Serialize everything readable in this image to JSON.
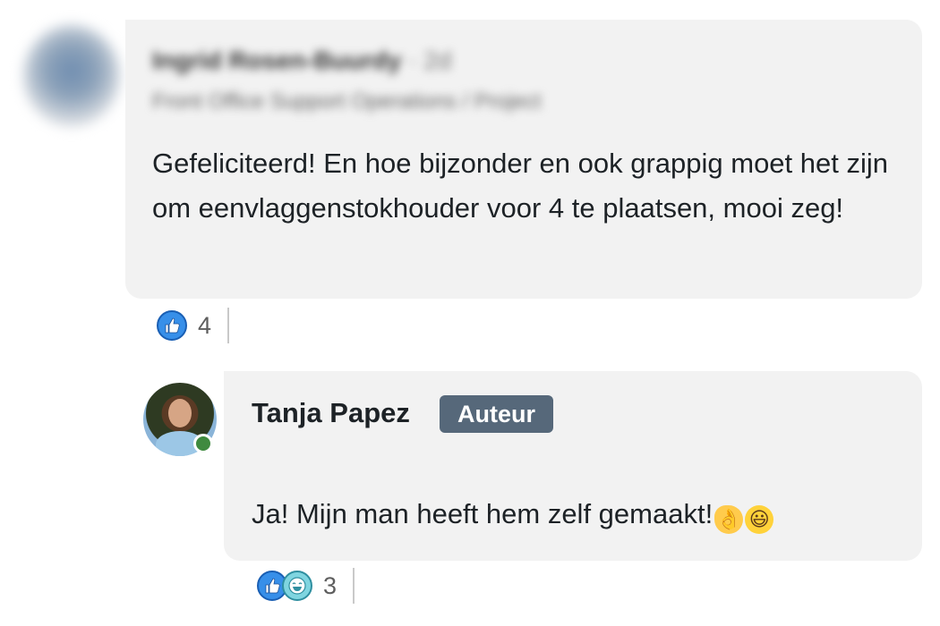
{
  "comment1": {
    "author_name": "Ingrid Rosen-Buurdy",
    "time": "2d",
    "headline": "Front Office Support Operations / Project",
    "text": "Gefeliciteerd! En hoe bijzonder en ook grappig moet het zijn om eenvlaggenstokhouder voor 4 te plaatsen, mooi zeg!",
    "reaction_count": "4"
  },
  "reply": {
    "author_name": "Tanja Papez",
    "badge": "Auteur",
    "text": "Ja! Mijn man heeft hem zelf gemaakt!",
    "emoji_1": "👌",
    "emoji_2": "😃",
    "reaction_count": "3"
  },
  "colors": {
    "bubble_bg": "#f2f2f2",
    "badge_bg": "#56687a",
    "like_blue": "#378fe9",
    "presence_green": "#3f8a3f"
  },
  "icons": [
    "like-icon",
    "funny-icon",
    "ok-hand-emoji",
    "grinning-face-emoji"
  ]
}
